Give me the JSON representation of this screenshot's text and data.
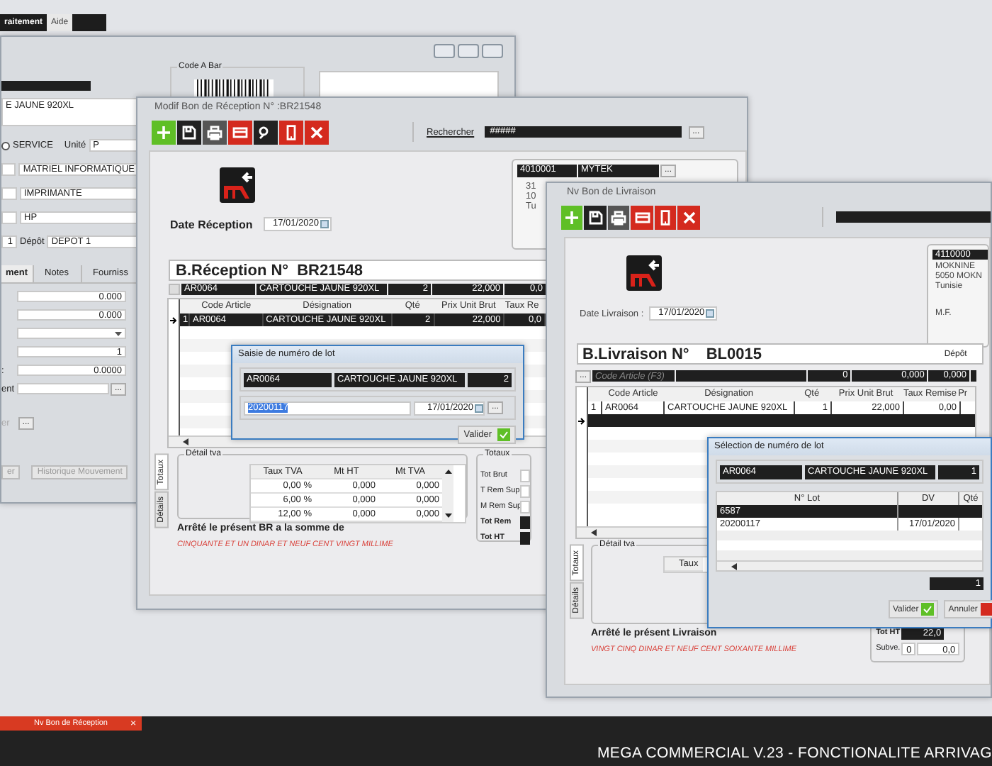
{
  "menu_tabs": [
    {
      "label": "raitement",
      "selected": true
    },
    {
      "label": "Aide",
      "selected": false
    }
  ],
  "article_window": {
    "code_bar_label": "Code A Bar",
    "designation": "E JAUNE 920XL",
    "service_radio": {
      "label": "SERVICE",
      "checked": false
    },
    "unit": {
      "label": "Unité",
      "value": "P"
    },
    "family": "MATRIEL INFORMATIQUE",
    "subfamily": "IMPRIMANTE",
    "brand": "HP",
    "quantity": "1",
    "depot": {
      "label": "Dépôt",
      "value": "DEPOT 1"
    },
    "tabs": [
      {
        "label": "ment",
        "selected": true
      },
      {
        "label": "Notes",
        "selected": false
      },
      {
        "label": "Fourniss",
        "selected": false
      }
    ],
    "fields": [
      {
        "kind": "text",
        "value": "0.000"
      },
      {
        "kind": "text",
        "value": "0.000"
      },
      {
        "kind": "select"
      },
      {
        "kind": "text",
        "value": "1"
      },
      {
        "kind": "text",
        "label": ":",
        "value": "0.0000"
      },
      {
        "kind": "lookup",
        "label": "ent",
        "button": "..."
      }
    ],
    "extra": {
      "label": "er",
      "button": "..."
    },
    "bottom_buttons": [
      {
        "label": "er",
        "disabled": true
      },
      {
        "label": "Historique Mouvement",
        "disabled": true
      }
    ]
  },
  "reception_window": {
    "title": "Modif  Bon de Réception N° :BR21548",
    "toolbar": [
      {
        "kind": "add"
      },
      {
        "kind": "save"
      },
      {
        "kind": "print"
      },
      {
        "kind": "card"
      },
      {
        "kind": "search"
      },
      {
        "kind": "phone"
      },
      {
        "kind": "close"
      }
    ],
    "search": {
      "label": "Rechercher",
      "value": "#####",
      "button": "..."
    },
    "date": {
      "label": "Date Réception",
      "value": "17/01/2020"
    },
    "supplier": {
      "code": "4010001",
      "name": "MYTEK",
      "button": "...",
      "lines": [
        "31",
        "10",
        "Tu"
      ]
    },
    "heading": {
      "label": "B.Réception N°",
      "number": "BR21548"
    },
    "entry": [
      "AR0064",
      "CARTOUCHE JAUNE 920XL",
      "2",
      "22,000",
      "0,0"
    ],
    "columns": [
      "Code Article",
      "Désignation",
      "Qté",
      "Prix Unit Brut",
      "Taux Re"
    ],
    "rows": [
      {
        "number": "1",
        "cells": [
          "AR0064",
          "CARTOUCHE JAUNE 920XL",
          "2",
          "22,000",
          "0,0"
        ],
        "selected": true
      }
    ],
    "lot_dialog": {
      "title": "Saisie de numéro de lot",
      "article": [
        "AR0064",
        "CARTOUCHE JAUNE 920XL",
        "2"
      ],
      "lot": "20200117",
      "date": "17/01/2020",
      "button": "...",
      "validate": "Valider"
    },
    "side_tabs": [
      {
        "label": "Totaux",
        "selected": true
      },
      {
        "label": "Détails",
        "selected": false
      }
    ],
    "vat": {
      "title": "Détail tva",
      "columns": [
        "Taux TVA",
        "Mt HT",
        "Mt TVA"
      ],
      "rows": [
        [
          "0,00 %",
          "0,000",
          "0,000"
        ],
        [
          "6,00 %",
          "0,000",
          "0,000"
        ],
        [
          "12,00 %",
          "0,000",
          "0,000"
        ]
      ]
    },
    "amount_label": "Arrêté le présent BR a la somme de",
    "amount_words": "CINQUANTE ET UN DINAR ET NEUF CENT VINGT MILLIME",
    "totals": {
      "title": "Totaux",
      "rows": [
        {
          "label": "Tot Brut",
          "kind": "plain"
        },
        {
          "label": "T Rem Sup",
          "kind": "plain"
        },
        {
          "label": "M Rem Sup",
          "kind": "plain"
        },
        {
          "label": "Tot Rem",
          "kind": "emphasis"
        },
        {
          "label": "Tot HT",
          "kind": "emphasis"
        }
      ]
    }
  },
  "delivery_window": {
    "title": "Nv Bon de Livraison",
    "toolbar": [
      {
        "kind": "add"
      },
      {
        "kind": "save"
      },
      {
        "kind": "print"
      },
      {
        "kind": "card"
      },
      {
        "kind": "phone"
      },
      {
        "kind": "close"
      }
    ],
    "date": {
      "label": "Date Livraison :",
      "value": "17/01/2020"
    },
    "client": {
      "code": "4110000",
      "lines": [
        "MOKNINE",
        "5050  MOKN",
        "Tunisie"
      ],
      "tax_label": "M.F."
    },
    "heading": {
      "label": "B.Livraison N°",
      "number": "BL0015",
      "depot_label": "Dépôt"
    },
    "entry": {
      "button": "...",
      "placeholder": "Code Article (F3)",
      "qty": "0",
      "price": "0,000",
      "discount": "0,000"
    },
    "columns": [
      "Code Article",
      "Désignation",
      "Qté",
      "Prix Unit Brut",
      "Taux Remise",
      "Pr"
    ],
    "rows": [
      {
        "number": "1",
        "cells": [
          "AR0064",
          "CARTOUCHE JAUNE 920XL",
          "1",
          "22,000",
          "0,00"
        ],
        "selected": false
      },
      {
        "selected": true
      }
    ],
    "lot_dialog": {
      "title": "Sélection de numéro de lot",
      "article": [
        "AR0064",
        "CARTOUCHE JAUNE 920XL",
        "1"
      ],
      "columns": [
        "N° Lot",
        "DV",
        "Qté"
      ],
      "rows": [
        {
          "cells": [
            "6587"
          ],
          "selected": true
        },
        {
          "cells": [
            "20200117",
            "17/01/2020"
          ],
          "selected": false
        }
      ],
      "count": "1",
      "buttons": [
        {
          "kind": "validate",
          "label": "Valider"
        },
        {
          "kind": "cancel",
          "label": "Annuler"
        }
      ]
    },
    "side_tabs": [
      {
        "label": "Totaux",
        "selected": true
      },
      {
        "label": "Détails",
        "selected": false
      }
    ],
    "vat": {
      "title": "Détail tva",
      "columns": [
        "Taux"
      ]
    },
    "amount_label": "Arrêté le présent Livraison",
    "amount_words": "VINGT CINQ DINAR ET NEUF CENT SOIXANTE MILLIME",
    "totals": [
      {
        "label": "Tot HT",
        "kind": "emphasis",
        "values": [
          "22,0"
        ]
      },
      {
        "label": "Subve.",
        "kind": "plain",
        "values": [
          "0",
          "0,0"
        ]
      }
    ]
  },
  "taskbar": {
    "tabs": [
      {
        "label": "Nv Bon de Réception",
        "close": "×"
      }
    ],
    "title": "MEGA COMMERCIAL V.23 - FONCTIONALITE ARRIVAG"
  }
}
